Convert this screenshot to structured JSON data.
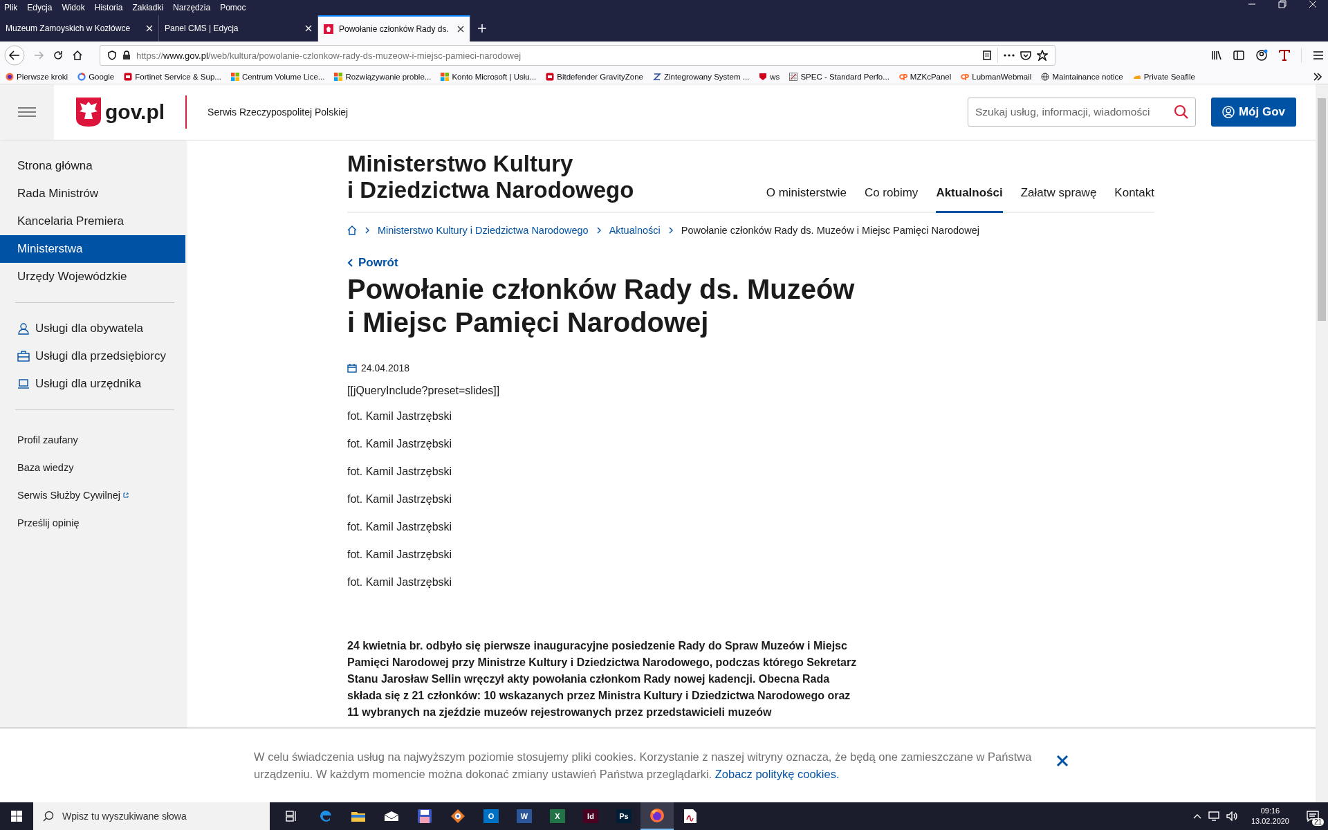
{
  "menu_bar": [
    "Plik",
    "Edycja",
    "Widok",
    "Historia",
    "Zakładki",
    "Narzędzia",
    "Pomoc"
  ],
  "tabs": [
    {
      "label": "Muzeum Zamoyskich w Kozłówce",
      "selected": false
    },
    {
      "label": "Panel CMS | Edycja",
      "selected": false
    },
    {
      "label": "Powołanie członków Rady ds.",
      "selected": true
    }
  ],
  "address_bar": {
    "scheme": "https://",
    "host": "www.gov.pl",
    "path": "/web/kultura/powolanie-czlonkow-rady-ds-muzeow-i-miejsc-pamieci-narodowej"
  },
  "bookmarks": [
    {
      "label": "Pierwsze kroki",
      "kind": "round"
    },
    {
      "label": "Google",
      "kind": "ring"
    },
    {
      "label": "Fortinet Service & Sup...",
      "kind": "square"
    },
    {
      "label": "Centrum Volume Lice...",
      "kind": "tiles"
    },
    {
      "label": "Rozwiązywanie proble...",
      "kind": "tiles"
    },
    {
      "label": "Konto Microsoft | Usłu...",
      "kind": "tiles"
    },
    {
      "label": "Bitdefender GravityZone",
      "kind": "square"
    },
    {
      "label": "Zintegrowany System ...",
      "kind": "slash"
    },
    {
      "label": "ws",
      "kind": "shield"
    },
    {
      "label": "SPEC - Standard Perfo...",
      "kind": "grid"
    },
    {
      "label": "MZKcPanel",
      "kind": "cp"
    },
    {
      "label": "LubmanWebmail",
      "kind": "cp"
    },
    {
      "label": "Maintainance notice",
      "kind": "globe"
    },
    {
      "label": "Private Seafile",
      "kind": "cloud"
    }
  ],
  "site_header": {
    "logo": "gov.pl",
    "tagline": "Serwis Rzeczypospolitej Polskiej",
    "search": {
      "placeholder": "Szukaj usług, informacji, wiadomości"
    },
    "account_button": "Mój Gov"
  },
  "sidebar": {
    "main_items": [
      {
        "label": "Strona główna",
        "selected": false
      },
      {
        "label": "Rada Ministrów",
        "selected": false
      },
      {
        "label": "Kancelaria Premiera",
        "selected": false
      },
      {
        "label": "Ministerstwa",
        "selected": true
      },
      {
        "label": "Urzędy Wojewódzkie",
        "selected": false
      }
    ],
    "services": [
      {
        "label": "Usługi dla obywatela",
        "kind": "person"
      },
      {
        "label": "Usługi dla przedsiębiorcy",
        "kind": "briefcase"
      },
      {
        "label": "Usługi dla urzędnika",
        "kind": "laptop"
      }
    ],
    "links": [
      {
        "label": "Profil zaufany",
        "external": false
      },
      {
        "label": "Baza wiedzy",
        "external": false
      },
      {
        "label": "Serwis Służby Cywilnej",
        "external": true
      },
      {
        "label": "Prześlij opinię",
        "external": false
      }
    ]
  },
  "ministry": {
    "title_lines": [
      "Ministerstwo Kultury",
      "i Dziedzictwa Narodowego"
    ],
    "nav": [
      {
        "label": "O ministerstwie",
        "selected": false
      },
      {
        "label": "Co robimy",
        "selected": false
      },
      {
        "label": "Aktualności",
        "selected": true
      },
      {
        "label": "Załatw sprawę",
        "selected": false
      },
      {
        "label": "Kontakt",
        "selected": false
      }
    ]
  },
  "breadcrumbs": [
    {
      "label": "Ministerstwo Kultury i Dziedzictwa Narodowego",
      "current": false
    },
    {
      "label": "Aktualności",
      "current": false
    },
    {
      "label": "Powołanie członków Rady ds. Muzeów i Miejsc Pamięci Narodowej",
      "current": true
    }
  ],
  "back_link": "Powrót",
  "article": {
    "title_lines": [
      "Powołanie członków Rady ds. Muzeów",
      "i Miejsc Pamięci Narodowej"
    ],
    "date": "24.04.2018",
    "body": [
      "[[jQueryInclude?preset=slides]]",
      "fot. Kamil Jastrzębski",
      "fot. Kamil Jastrzębski",
      "fot. Kamil Jastrzębski",
      "fot. Kamil Jastrzębski",
      "fot. Kamil Jastrzębski",
      "fot. Kamil Jastrzębski",
      "fot. Kamil Jastrzębski"
    ],
    "lead_lines": [
      "24 kwietnia br. odbyło się pierwsze inauguracyjne posiedzenie Rady do Spraw Muzeów i Miejsc",
      "Pamięci Narodowej przy Ministrze Kultury i Dziedzictwa Narodowego, podczas którego Sekretarz",
      "Stanu Jarosław Sellin wręczył akty powołania członkom Rady nowej kadencji. Obecna Rada",
      "składa się z 21 członków: 10 wskazanych przez Ministra Kultury i Dziedzictwa Narodowego oraz",
      "11 wybranych na zjeździe muzeów rejestrowanych przez przedstawicieli muzeów"
    ]
  },
  "cookie_notice": {
    "text": "W celu świadczenia usług na najwyższym poziomie stosujemy pliki cookies. Korzystanie z naszej witryny oznacza, że będą one zamieszczane w Państwa urządzeniu. W każdym momencie można dokonać zmiany ustawień Państwa przeglądarki.",
    "link": "Zobacz politykę cookies."
  },
  "taskbar": {
    "search_placeholder": "Wpisz tu wyszukiwane słowa",
    "apps": [
      {
        "kind": "taskview",
        "selected": false
      },
      {
        "kind": "edge",
        "selected": false
      },
      {
        "kind": "folder",
        "selected": false
      },
      {
        "kind": "mail",
        "selected": false
      },
      {
        "kind": "disk",
        "selected": false
      },
      {
        "kind": "eye",
        "selected": false
      },
      {
        "kind": "tile",
        "label": "O",
        "color": "#0072c6",
        "selected": false
      },
      {
        "kind": "tile",
        "label": "W",
        "color": "#2b579a",
        "selected": false
      },
      {
        "kind": "tile",
        "label": "X",
        "color": "#217346",
        "selected": false
      },
      {
        "kind": "tile",
        "label": "Id",
        "color": "#49021f",
        "selected": false
      },
      {
        "kind": "tile",
        "label": "Ps",
        "color": "#001e36",
        "selected": false
      },
      {
        "kind": "firefox",
        "selected": true
      },
      {
        "kind": "pdf",
        "selected": false
      }
    ],
    "time": "09:16",
    "date": "13.02.2020",
    "notifications": "21"
  }
}
